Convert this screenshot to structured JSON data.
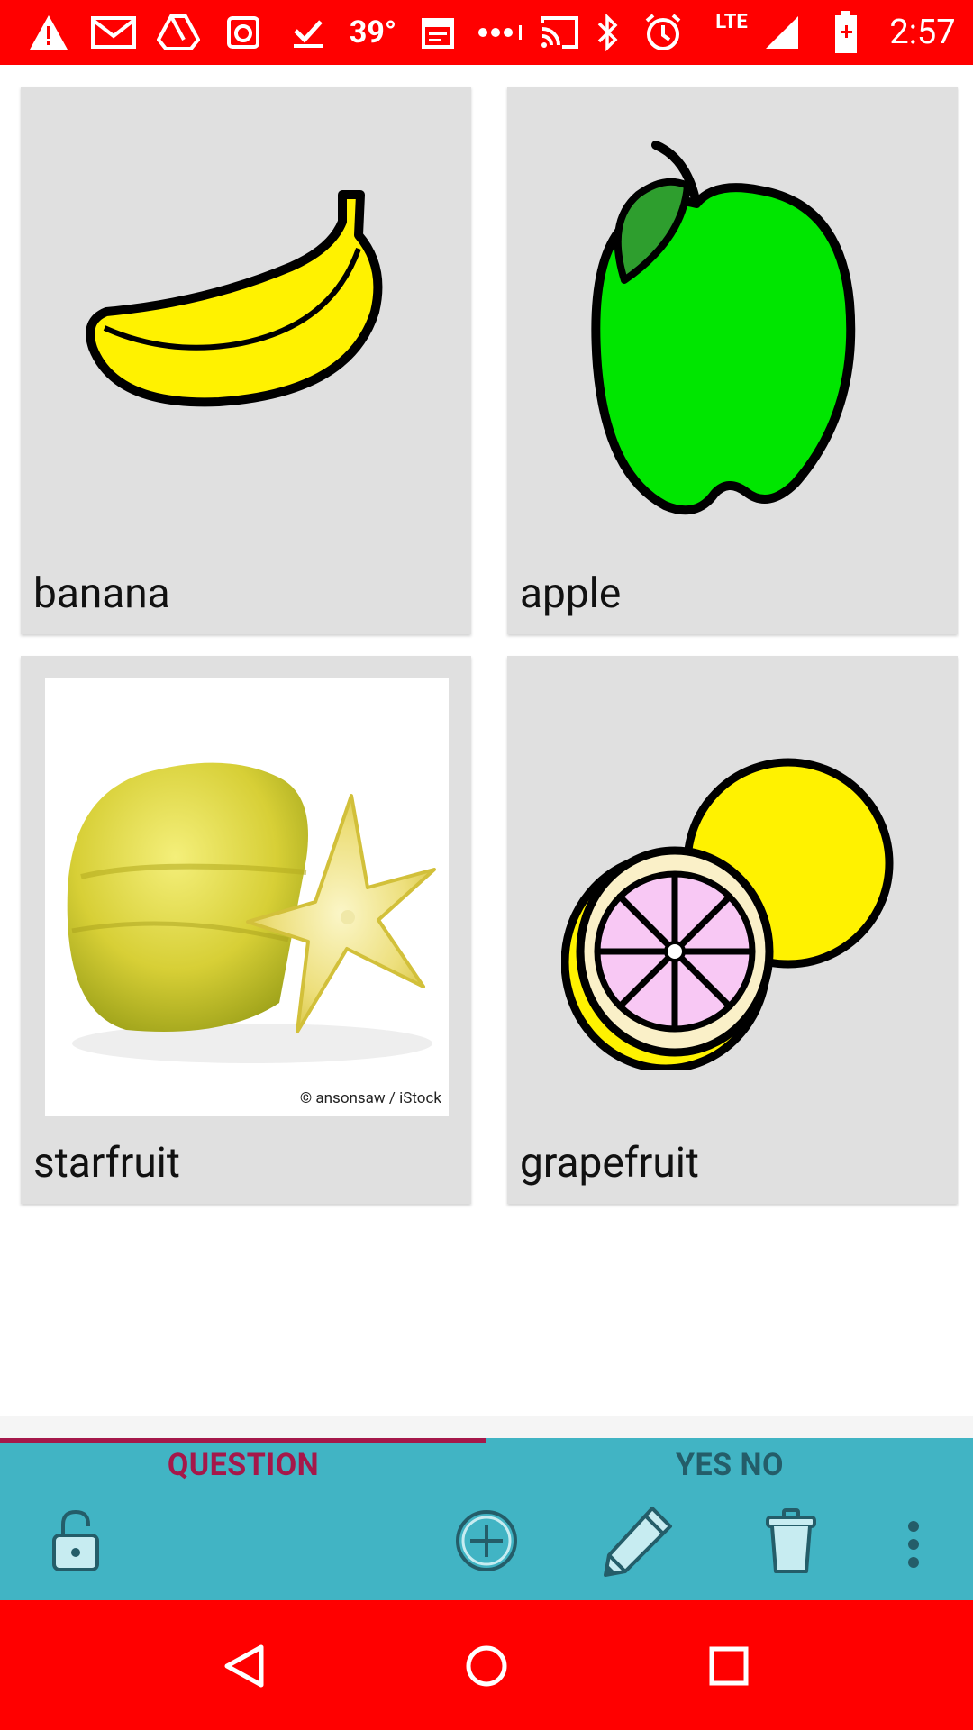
{
  "status_bar": {
    "temperature": "39°",
    "network": "LTE",
    "time": "2:57"
  },
  "grid": {
    "items": [
      {
        "label": "banana"
      },
      {
        "label": "apple"
      },
      {
        "label": "starfruit",
        "photo_credit": "© ansonsaw / iStock"
      },
      {
        "label": "grapefruit"
      }
    ]
  },
  "tabs": [
    {
      "label": "QUESTION",
      "selected": true
    },
    {
      "label": "YES NO",
      "selected": false
    }
  ],
  "colors": {
    "status_bar": "#ff0000",
    "nav_bar": "#ff0000",
    "panel": "#41b4c4",
    "tab_selected": "#a5184a",
    "tab_unselected": "#245d69",
    "card": "#e0e0e0"
  },
  "toolbar": {
    "icons": [
      "lock-open-icon",
      "add-circle-icon",
      "pencil-icon",
      "trash-icon",
      "more-vert-icon"
    ]
  }
}
